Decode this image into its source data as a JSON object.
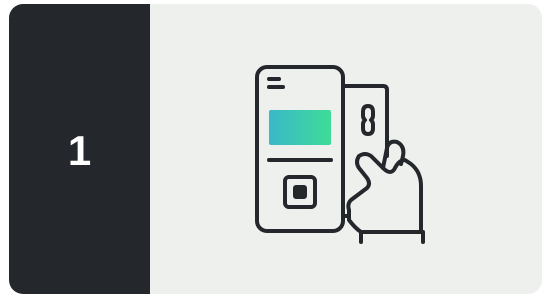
{
  "step": {
    "number": "1"
  },
  "illustration": {
    "icon": "payment-terminal-card-icon",
    "colors": {
      "background": "#eef0ee",
      "panel": "#24272b",
      "stroke": "#24272b",
      "gradient_start": "#3ab8c8",
      "gradient_end": "#3fdc98"
    }
  }
}
